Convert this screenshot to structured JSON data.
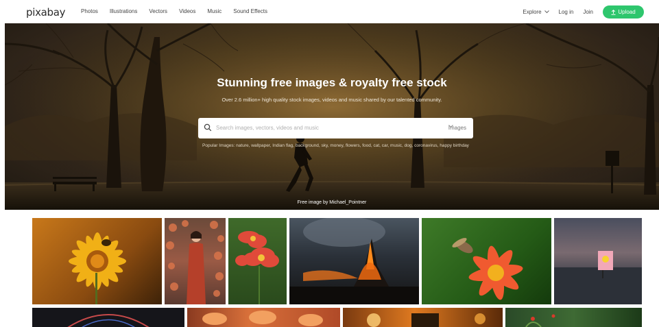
{
  "header": {
    "logo": "pixabay",
    "nav": [
      "Photos",
      "Illustrations",
      "Vectors",
      "Videos",
      "Music",
      "Sound Effects"
    ],
    "explore": "Explore",
    "login": "Log in",
    "join": "Join",
    "upload": "Upload"
  },
  "hero": {
    "title": "Stunning free images & royalty free stock",
    "subtitle": "Over 2.6 million+ high quality stock images, videos and music shared by our talented community.",
    "search_placeholder": "Search images, vectors, videos and music",
    "search_type": "Images",
    "popular": "Popular Images: nature, wallpaper, Indian flag, background, sky, money, flowers, food, cat, car, music, dog, coronavirus, happy birthday",
    "credit": "Free image by Michael_Pointner"
  },
  "colors": {
    "accent": "#2ec66d"
  },
  "icons": {
    "search": "search-icon",
    "upload": "upload-icon",
    "chevron": "chevron-down-icon"
  }
}
